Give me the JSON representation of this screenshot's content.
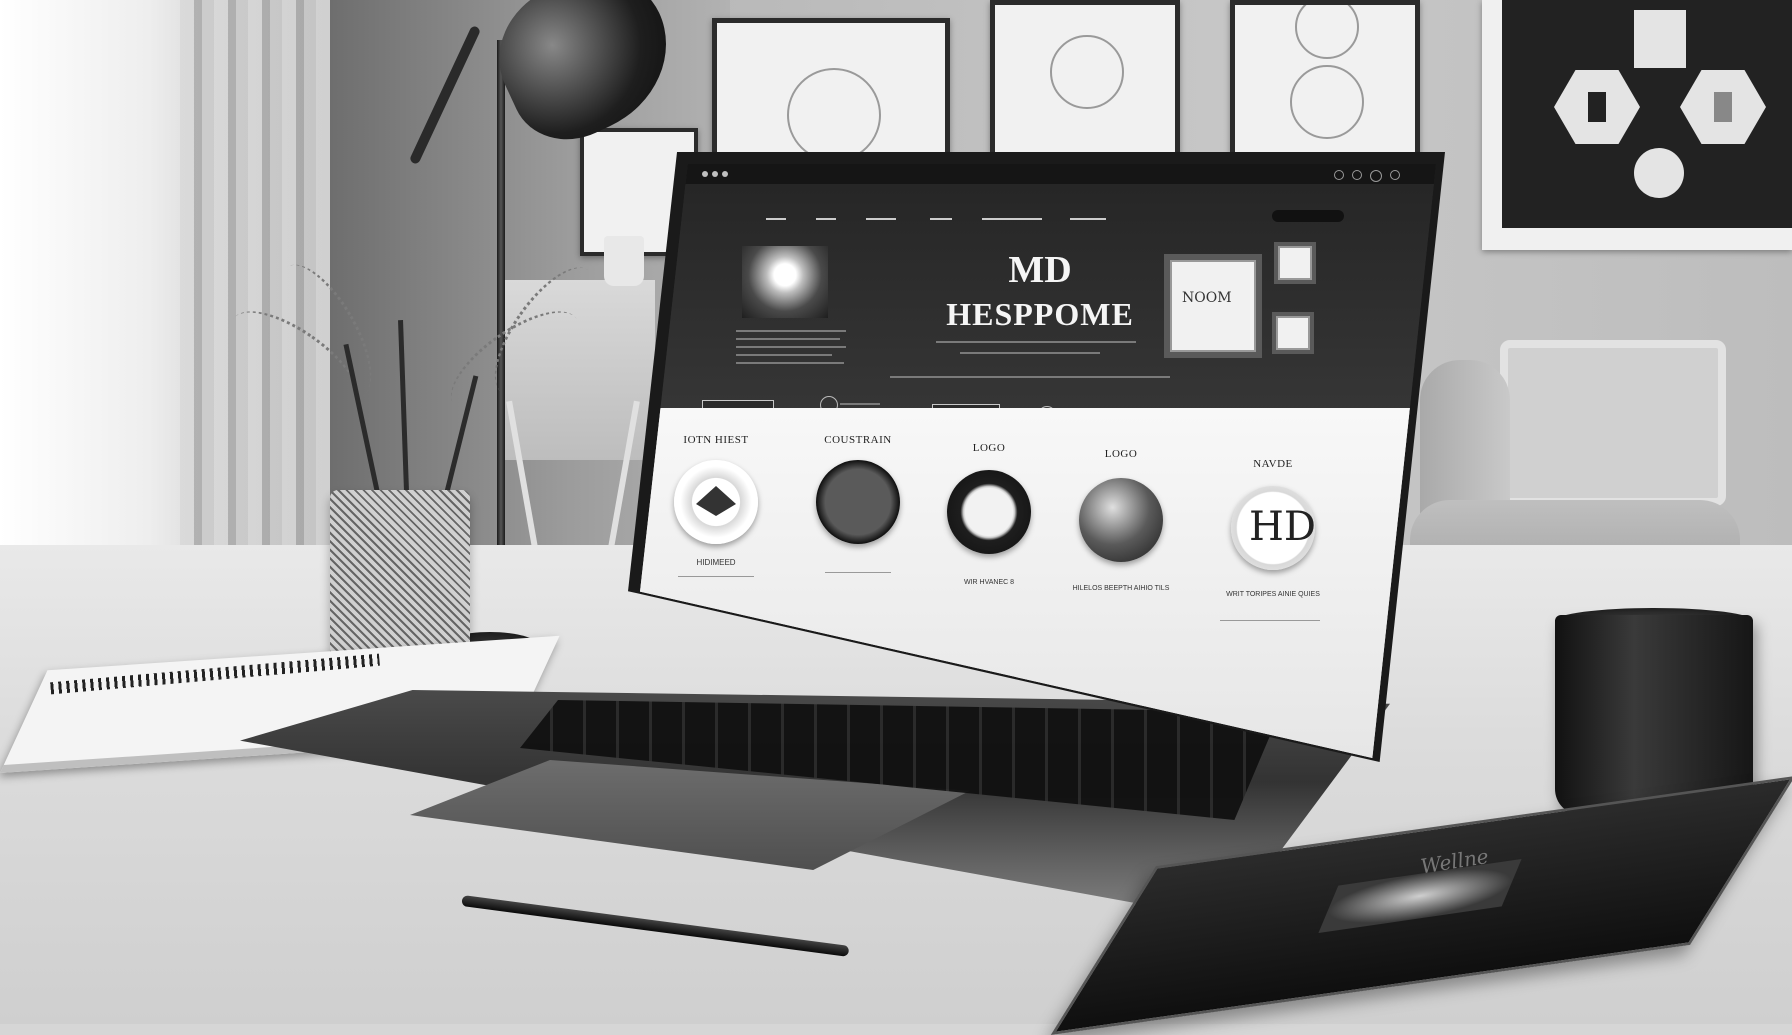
{
  "screen": {
    "hero": {
      "title": "MD",
      "subtitle": "HESPPOME"
    },
    "cards": [
      {
        "title": "IOTN HIEST",
        "caption": "HIDIMEED"
      },
      {
        "title": "COUSTRAIN",
        "caption": ""
      },
      {
        "title": "LOGO",
        "caption": "WIR HVANEC 8"
      },
      {
        "title": "LOGO",
        "caption": "HILELOS BEEPTH AIHIO TILS"
      },
      {
        "title": "NAVDE",
        "caption": "WRIT TORIPES AINIE QUIES"
      }
    ],
    "frame_logo": "NOOM"
  },
  "book": {
    "title": "Wellne"
  },
  "colors": {
    "screen_dark": "#262626",
    "card_bg": "#f0f0f0",
    "mug": "#1a1a1a"
  }
}
